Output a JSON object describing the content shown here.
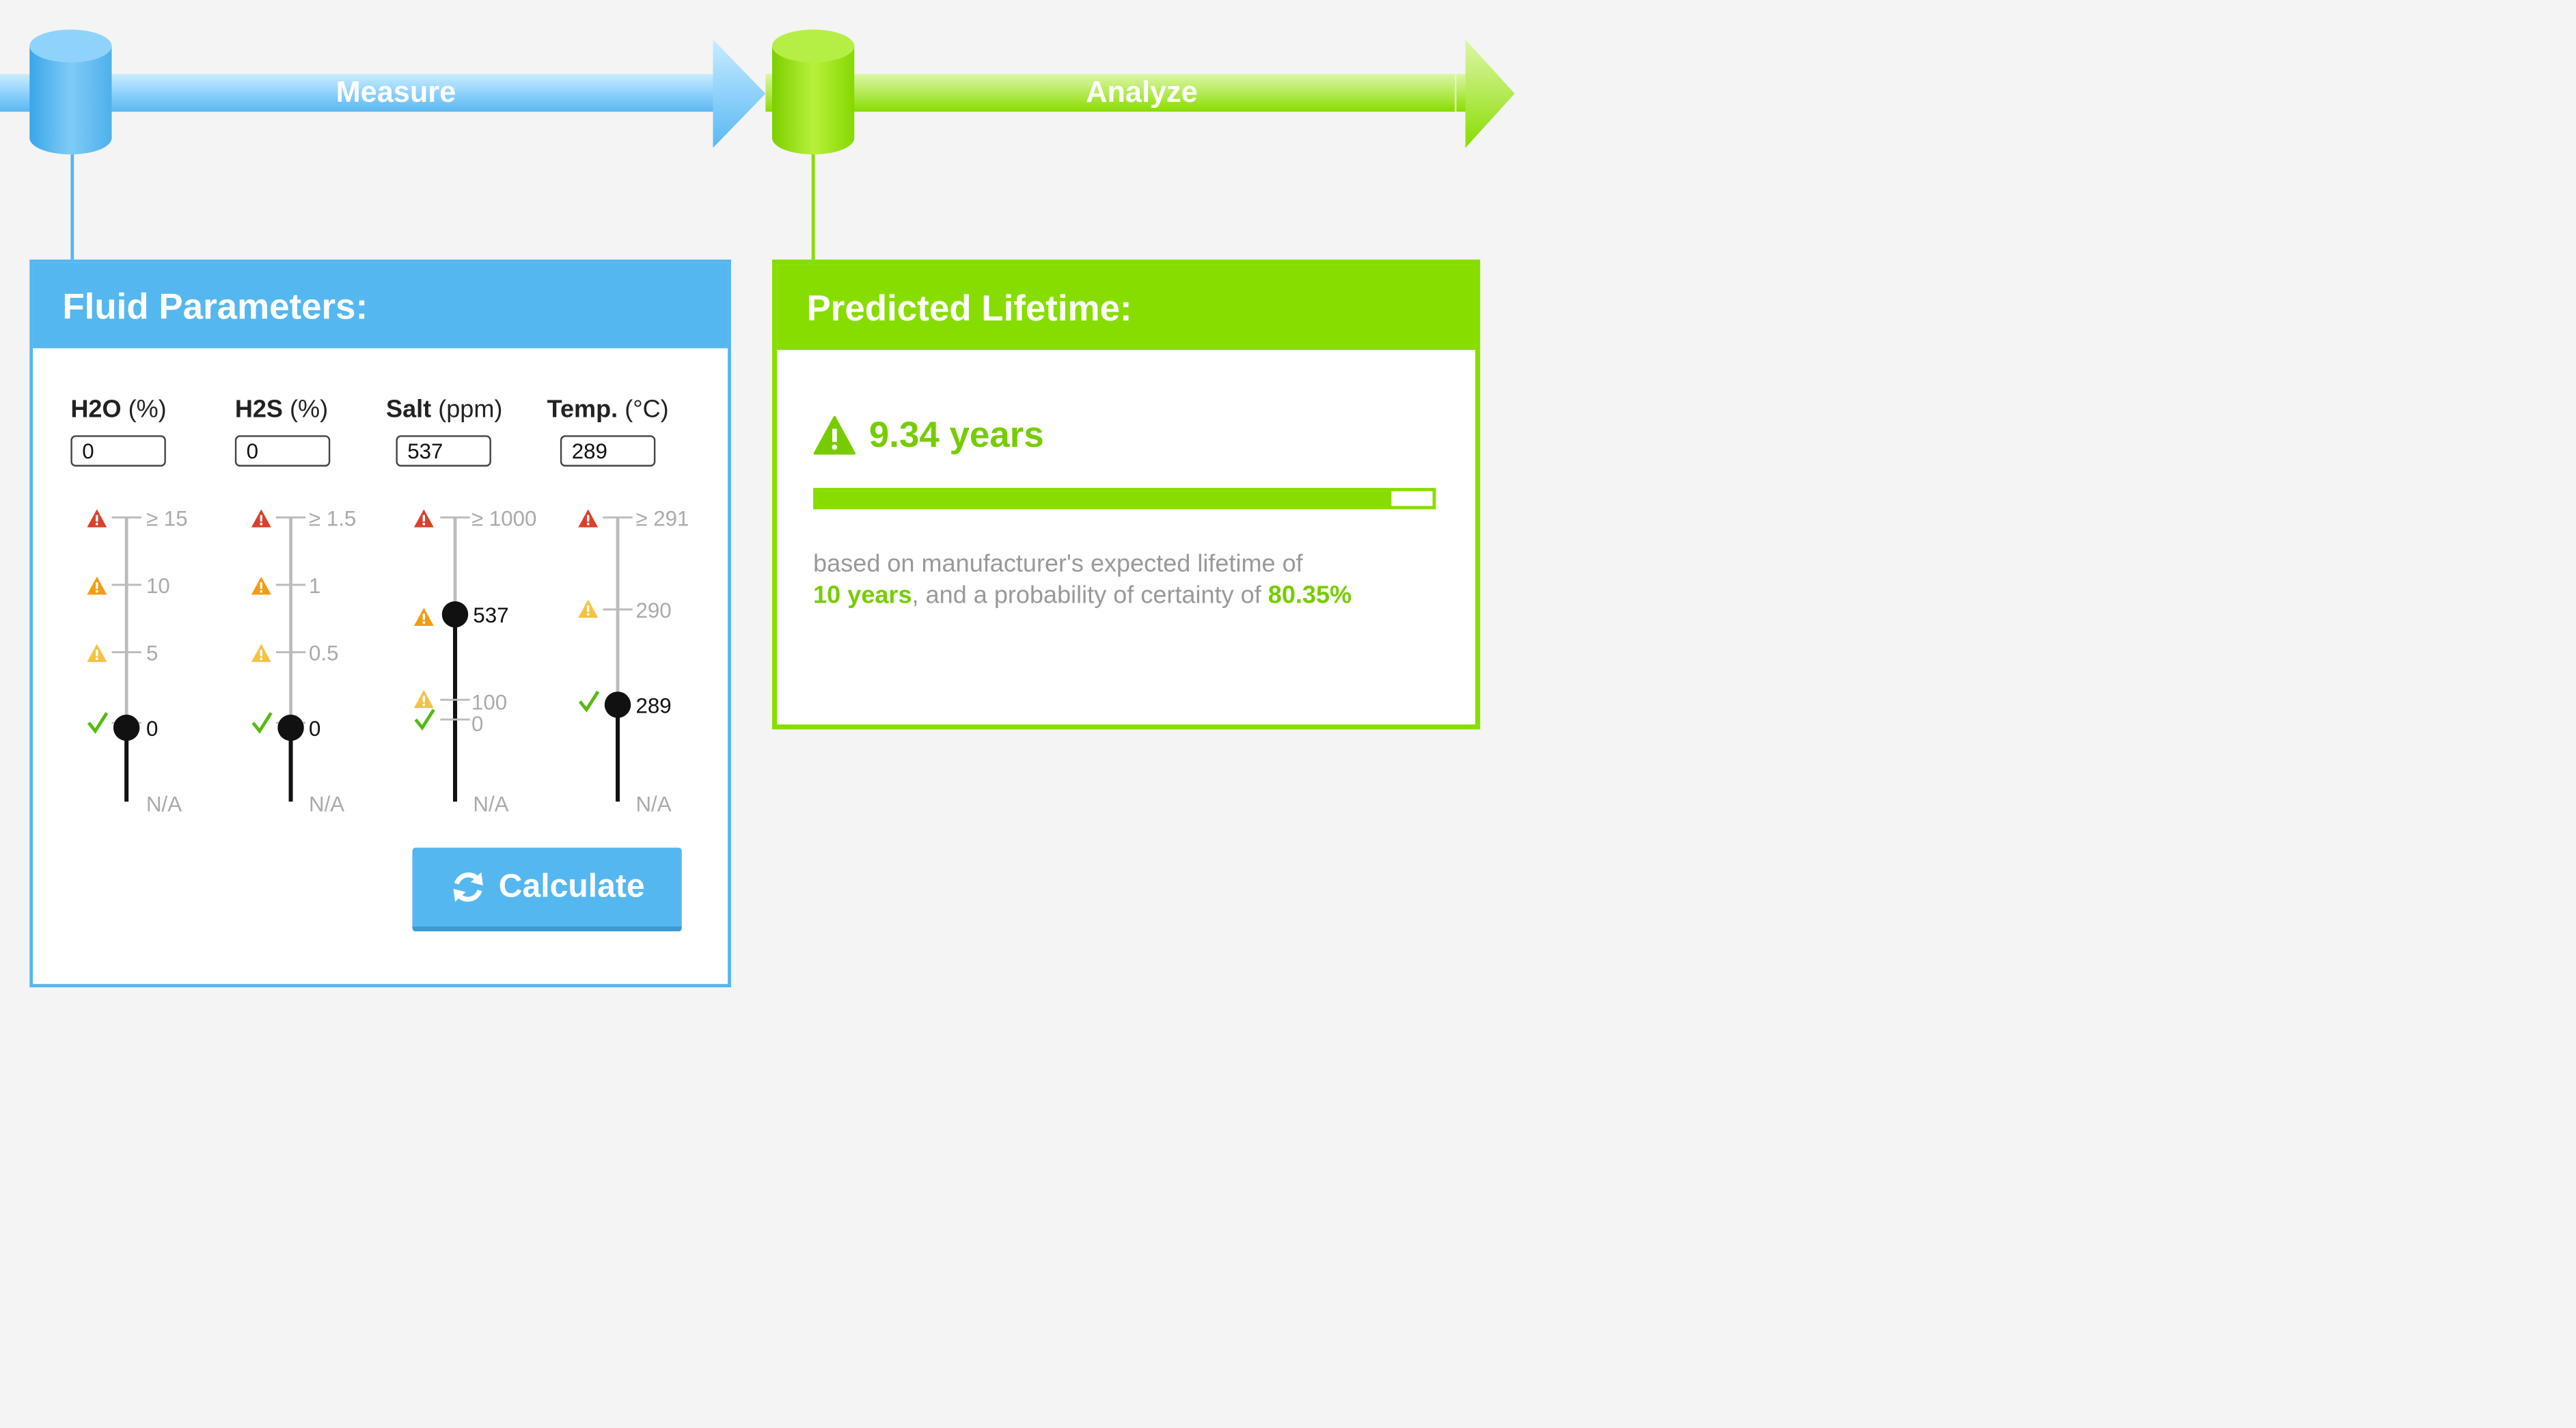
{
  "pipeline": {
    "stages": [
      {
        "label": "Measure",
        "color": "#55b7ef"
      },
      {
        "label": "Analyze",
        "color": "#88dd00"
      }
    ]
  },
  "fluid_card": {
    "title": "Fluid Parameters:",
    "params": [
      {
        "name": "H2O",
        "unit": "(%)",
        "value": "0",
        "ticks": [
          "≥ 15",
          "10",
          "5",
          "0"
        ],
        "na": "N/A",
        "reading": "0"
      },
      {
        "name": "H2S",
        "unit": "(%)",
        "value": "0",
        "ticks": [
          "≥ 1.5",
          "1",
          "0.5",
          "0"
        ],
        "na": "N/A",
        "reading": "0"
      },
      {
        "name": "Salt",
        "unit": "(ppm)",
        "value": "537",
        "ticks": [
          "≥ 1000",
          "100",
          "0"
        ],
        "na": "N/A",
        "reading": "537"
      },
      {
        "name": "Temp.",
        "unit": "(°C)",
        "value": "289",
        "ticks": [
          "≥ 291",
          "290"
        ],
        "na": "N/A",
        "reading": "289"
      }
    ],
    "calculate_label": "Calculate"
  },
  "result_card": {
    "title": "Predicted Lifetime:",
    "lifetime": "9.34 years",
    "progress_fraction": 0.934,
    "desc_prefix": "based on manufacturer's expected lifetime of",
    "expected_lifetime": "10 years",
    "desc_mid": ", and a probability of certainty of",
    "certainty": "80.35%"
  },
  "colors": {
    "blue": "#55b7ef",
    "green": "#88dd00",
    "danger": "#d9412b",
    "caution": "#f39c12",
    "warning": "#f5c242",
    "ok": "#55bb11"
  }
}
